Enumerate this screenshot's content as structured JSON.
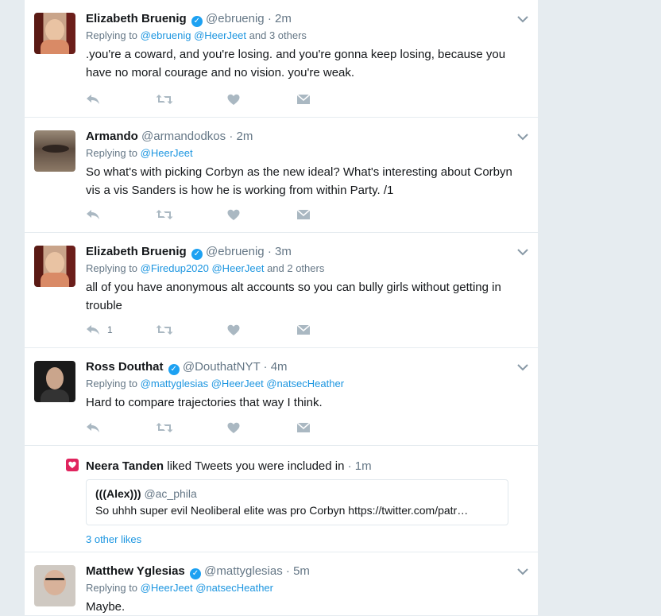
{
  "tweets": [
    {
      "name": "Elizabeth Bruenig",
      "verified": true,
      "handle": "@ebruenig",
      "dot": "·",
      "time": "2m",
      "replying_label": "Replying to",
      "mentions": "@ebruenig @HeerJeet",
      "others": "and 3 others",
      "text": ".you're a coward, and you're losing. and you're gonna keep losing, because you have no moral courage and no vision. you're weak."
    },
    {
      "name": "Armando",
      "verified": false,
      "handle": "@armandodkos",
      "dot": "·",
      "time": "2m",
      "replying_label": "Replying to",
      "mentions": "@HeerJeet",
      "others": "",
      "text": "So what's with picking Corbyn as the new ideal? What's interesting about Corbyn vis a vis Sanders is how he is working from within Party. /1"
    },
    {
      "name": "Elizabeth Bruenig",
      "verified": true,
      "handle": "@ebruenig",
      "dot": "·",
      "time": "3m",
      "replying_label": "Replying to",
      "mentions": "@Firedup2020 @HeerJeet",
      "others": "and 2 others",
      "text": "all of you have anonymous alt accounts so you can bully girls without getting in trouble",
      "reply_count": "1"
    },
    {
      "name": "Ross Douthat",
      "verified": true,
      "handle": "@DouthatNYT",
      "dot": "·",
      "time": "4m",
      "replying_label": "Replying to",
      "mentions": "@mattyglesias @HeerJeet @natsecHeather",
      "others": "",
      "text": "Hard to compare trajectories that way I think."
    },
    {
      "name": "Matthew Yglesias",
      "verified": true,
      "handle": "@mattyglesias",
      "dot": "·",
      "time": "5m",
      "replying_label": "Replying to",
      "mentions": "@HeerJeet @natsecHeather",
      "others": "",
      "text": "Maybe."
    }
  ],
  "notification": {
    "liker": "Neera Tanden",
    "action": "liked Tweets you were included in",
    "dot": "·",
    "time": "1m",
    "quote": {
      "name": "(((Alex)))",
      "handle": "@ac_phila",
      "text": "So uhhh super evil Neoliberal elite was pro Corbyn https://twitter.com/patr…"
    },
    "other_likes": "3 other likes"
  },
  "icons": {
    "reply": "reply-icon",
    "retweet": "retweet-icon",
    "like": "heart-icon",
    "dm": "envelope-icon",
    "caret": "chevron-down-icon",
    "verified": "verified-badge-icon"
  },
  "colors": {
    "link": "#1b95e0",
    "verified": "#1da1f2",
    "like_badge": "#e0245e",
    "action_icon": "#aab8c2",
    "muted_text": "#657786"
  }
}
